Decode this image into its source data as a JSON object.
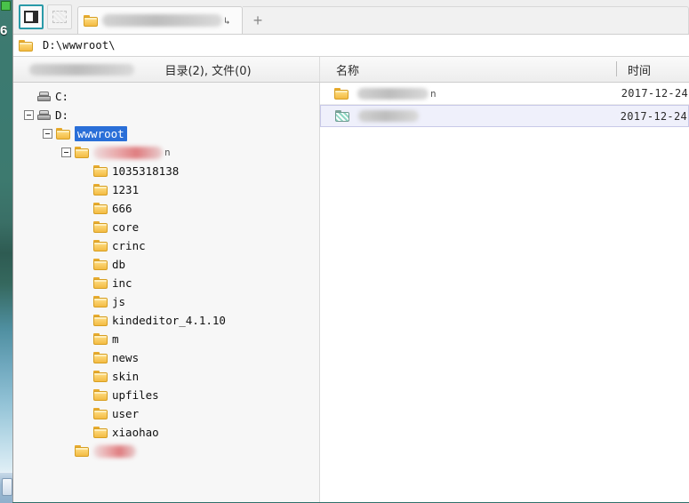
{
  "window": {
    "toolbar": {
      "pane_toggle_label": "",
      "pane_toggle_icon": "split-pane-icon",
      "secondary_toggle_icon": "dashed-pane-icon"
    },
    "tabs": {
      "active_tab_icon": "folder-icon",
      "active_tab_label": "",
      "new_tab_label": "+"
    },
    "address": {
      "icon": "folder-icon",
      "path": "D:\\wwwroot\\"
    }
  },
  "header": {
    "left_blurred_label": "",
    "count_summary": "目录(2), 文件(0)",
    "name_column": "名称",
    "time_column": "时间"
  },
  "tree": {
    "items": [
      {
        "label": "C:",
        "icon": "drive-icon",
        "indent": 0,
        "expander": "none",
        "selected": false,
        "redacted": false
      },
      {
        "label": "D:",
        "icon": "drive-icon",
        "indent": 0,
        "expander": "minus",
        "selected": false,
        "redacted": false
      },
      {
        "label": "wwwroot",
        "icon": "folder-icon",
        "indent": 1,
        "expander": "minus",
        "selected": true,
        "redacted": false
      },
      {
        "label": "",
        "icon": "folder-icon",
        "indent": 2,
        "expander": "minus",
        "selected": false,
        "redacted": "pink",
        "redact_width": 78,
        "tail": "n"
      },
      {
        "label": "1035318138",
        "icon": "folder-icon",
        "indent": 3,
        "expander": "none",
        "selected": false,
        "redacted": false
      },
      {
        "label": "1231",
        "icon": "folder-icon",
        "indent": 3,
        "expander": "none",
        "selected": false,
        "redacted": false
      },
      {
        "label": "666",
        "icon": "folder-icon",
        "indent": 3,
        "expander": "none",
        "selected": false,
        "redacted": false
      },
      {
        "label": "core",
        "icon": "folder-icon",
        "indent": 3,
        "expander": "none",
        "selected": false,
        "redacted": false
      },
      {
        "label": "crinc",
        "icon": "folder-icon",
        "indent": 3,
        "expander": "none",
        "selected": false,
        "redacted": false
      },
      {
        "label": "db",
        "icon": "folder-icon",
        "indent": 3,
        "expander": "none",
        "selected": false,
        "redacted": false
      },
      {
        "label": "inc",
        "icon": "folder-icon",
        "indent": 3,
        "expander": "none",
        "selected": false,
        "redacted": false
      },
      {
        "label": "js",
        "icon": "folder-icon",
        "indent": 3,
        "expander": "none",
        "selected": false,
        "redacted": false
      },
      {
        "label": "kindeditor_4.1.10",
        "icon": "folder-icon",
        "indent": 3,
        "expander": "none",
        "selected": false,
        "redacted": false
      },
      {
        "label": "m",
        "icon": "folder-icon",
        "indent": 3,
        "expander": "none",
        "selected": false,
        "redacted": false
      },
      {
        "label": "news",
        "icon": "folder-icon",
        "indent": 3,
        "expander": "none",
        "selected": false,
        "redacted": false
      },
      {
        "label": "skin",
        "icon": "folder-icon",
        "indent": 3,
        "expander": "none",
        "selected": false,
        "redacted": false
      },
      {
        "label": "upfiles",
        "icon": "folder-icon",
        "indent": 3,
        "expander": "none",
        "selected": false,
        "redacted": false
      },
      {
        "label": "user",
        "icon": "folder-icon",
        "indent": 3,
        "expander": "none",
        "selected": false,
        "redacted": false
      },
      {
        "label": "xiaohao",
        "icon": "folder-icon",
        "indent": 3,
        "expander": "none",
        "selected": false,
        "redacted": false
      },
      {
        "label": "",
        "icon": "folder-icon",
        "indent": 2,
        "expander": "none",
        "selected": false,
        "redacted": "pink",
        "redact_width": 48,
        "tail": ""
      }
    ]
  },
  "list": {
    "rows": [
      {
        "icon": "folder-icon",
        "name": "",
        "redact_width": 80,
        "tail": "n",
        "time": "2017-12-24",
        "selected": false
      },
      {
        "icon": "special-folder-icon",
        "name": "",
        "redact_width": 68,
        "tail": "",
        "time": "2017-12-24",
        "selected": true
      }
    ]
  },
  "desktop": {
    "glyph": "6"
  }
}
